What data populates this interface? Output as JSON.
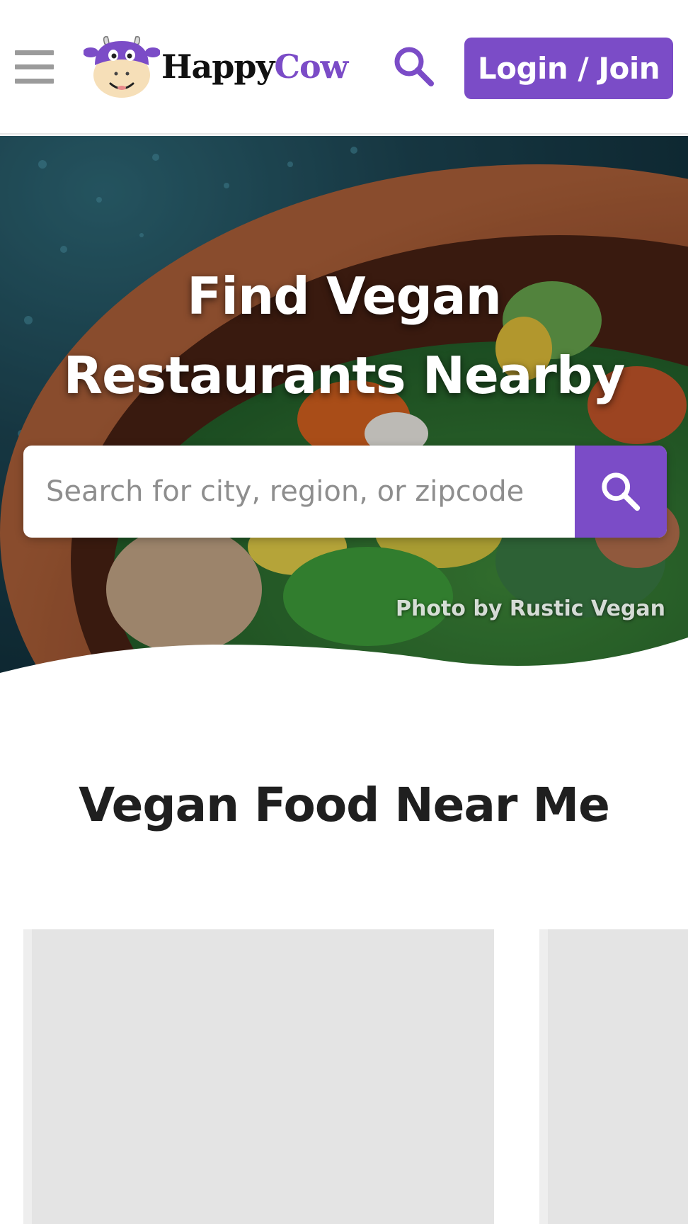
{
  "header": {
    "logo": {
      "happy": "Happy",
      "cow": "Cow"
    },
    "login_label": "Login / Join"
  },
  "hero": {
    "title_line1": "Find Vegan",
    "title_line2": "Restaurants Nearby",
    "search": {
      "placeholder": "Search for city, region, or zipcode",
      "value": ""
    },
    "photo_credit": "Photo by Rustic Vegan"
  },
  "section": {
    "title": "Vegan Food Near Me",
    "cards": [
      {},
      {}
    ]
  },
  "colors": {
    "brand": "#7b4cc7",
    "menu_icon": "#9b9b9b",
    "card_placeholder": "#e4e4e4"
  },
  "icons": {
    "menu": "hamburger-menu-icon",
    "search": "search-icon",
    "logo": "happycow-logo-icon"
  }
}
